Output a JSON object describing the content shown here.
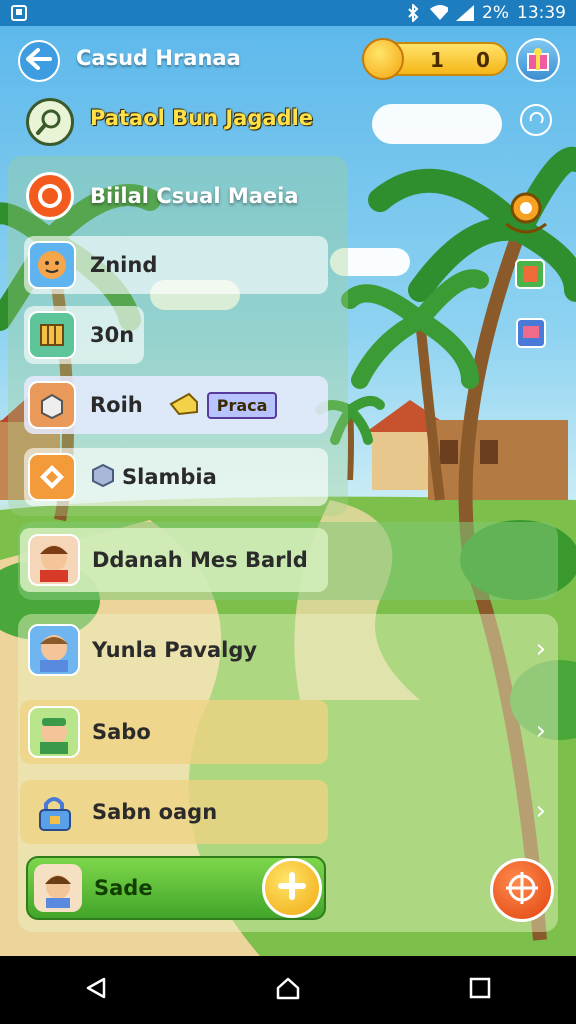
{
  "status_bar": {
    "time": "13:39",
    "battery": "2%"
  },
  "header": {
    "title": "Casud Hranaa",
    "coins_left": "1",
    "coins_right": "0"
  },
  "location": {
    "title": "Pataol Bun Jagadle"
  },
  "section": {
    "title": "Biilal Csual Maeia"
  },
  "menu": {
    "items": [
      {
        "label": "Znind"
      },
      {
        "label": "30n"
      },
      {
        "label": "Roih",
        "tag": "Praca"
      },
      {
        "label": "Slambia"
      }
    ]
  },
  "friends": {
    "highlight": "Ddanah Mes Barld",
    "items": [
      {
        "name": "Yunla Pavalgy"
      },
      {
        "name": "Sabo"
      },
      {
        "name": "Sabn oagn"
      }
    ],
    "action_label": "Sade"
  },
  "colors": {
    "status_bar": "#1d7dbf",
    "accent_orange": "#f35a1e",
    "coin_gold": "#f4b616",
    "action_green": "#42a52a"
  }
}
